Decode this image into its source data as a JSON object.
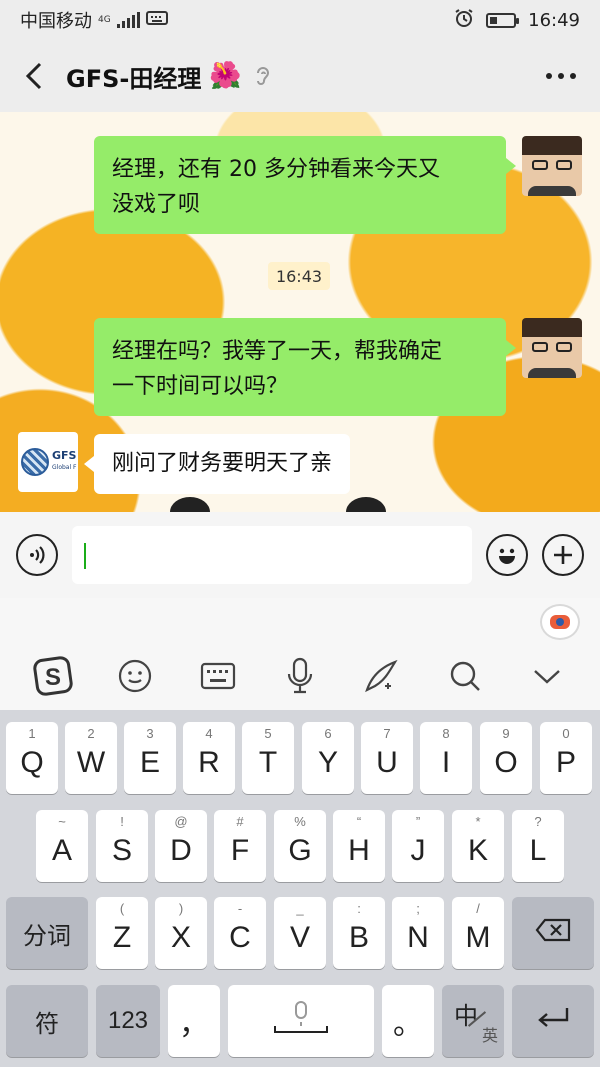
{
  "status_bar": {
    "carrier": "中国移动",
    "network": "4G",
    "time": "16:49",
    "icons": [
      "signal-icon",
      "keyboard-status-icon",
      "alarm-icon",
      "battery-icon"
    ]
  },
  "header": {
    "title": "GFS-田经理",
    "title_emoji": "🌺",
    "back_icon": "chevron-left-icon",
    "mute_icon": "ear-icon",
    "more_icon": "more-dots-icon"
  },
  "messages": [
    {
      "sender": "me",
      "text_line1": "经理，还有 20 多分钟看来今天又",
      "text_line2": "没戏了呗"
    },
    {
      "type": "timestamp",
      "text": "16:43"
    },
    {
      "sender": "me",
      "text_line1": "经理在吗？我等了一天，帮我确定",
      "text_line2": "一下时间可以吗？"
    },
    {
      "sender": "them",
      "text": "刚问了财务要明天了亲",
      "avatar_text": "GFS",
      "avatar_subtext": "Global F"
    }
  ],
  "input_bar": {
    "voice_icon": "voice-icon",
    "value": "",
    "emoji_icon": "emoji-icon",
    "plus_icon": "plus-icon"
  },
  "keyboard_toolbar": {
    "items": [
      "sogou-logo-icon",
      "smiley-icon",
      "keyboard-icon",
      "microphone-icon",
      "handwriting-icon",
      "search-icon",
      "chevron-down-icon"
    ]
  },
  "keyboard": {
    "row1": [
      {
        "hint": "1",
        "label": "Q"
      },
      {
        "hint": "2",
        "label": "W"
      },
      {
        "hint": "3",
        "label": "E"
      },
      {
        "hint": "4",
        "label": "R"
      },
      {
        "hint": "5",
        "label": "T"
      },
      {
        "hint": "6",
        "label": "Y"
      },
      {
        "hint": "7",
        "label": "U"
      },
      {
        "hint": "8",
        "label": "I"
      },
      {
        "hint": "9",
        "label": "O"
      },
      {
        "hint": "0",
        "label": "P"
      }
    ],
    "row2": [
      {
        "hint": "~",
        "label": "A"
      },
      {
        "hint": "!",
        "label": "S"
      },
      {
        "hint": "@",
        "label": "D"
      },
      {
        "hint": "#",
        "label": "F"
      },
      {
        "hint": "%",
        "label": "G"
      },
      {
        "hint": "“",
        "label": "H"
      },
      {
        "hint": "”",
        "label": "J"
      },
      {
        "hint": "*",
        "label": "K"
      },
      {
        "hint": "?",
        "label": "L"
      }
    ],
    "row3_left": "分词",
    "row3": [
      {
        "hint": "(",
        "label": "Z"
      },
      {
        "hint": ")",
        "label": "X"
      },
      {
        "hint": "-",
        "label": "C"
      },
      {
        "hint": "_",
        "label": "V"
      },
      {
        "hint": ":",
        "label": "B"
      },
      {
        "hint": ";",
        "label": "N"
      },
      {
        "hint": "/",
        "label": "M"
      }
    ],
    "row4": {
      "symbols": "符",
      "numbers": "123",
      "comma": "，",
      "period": "。",
      "lang_main": "中",
      "lang_alt": "英"
    }
  }
}
